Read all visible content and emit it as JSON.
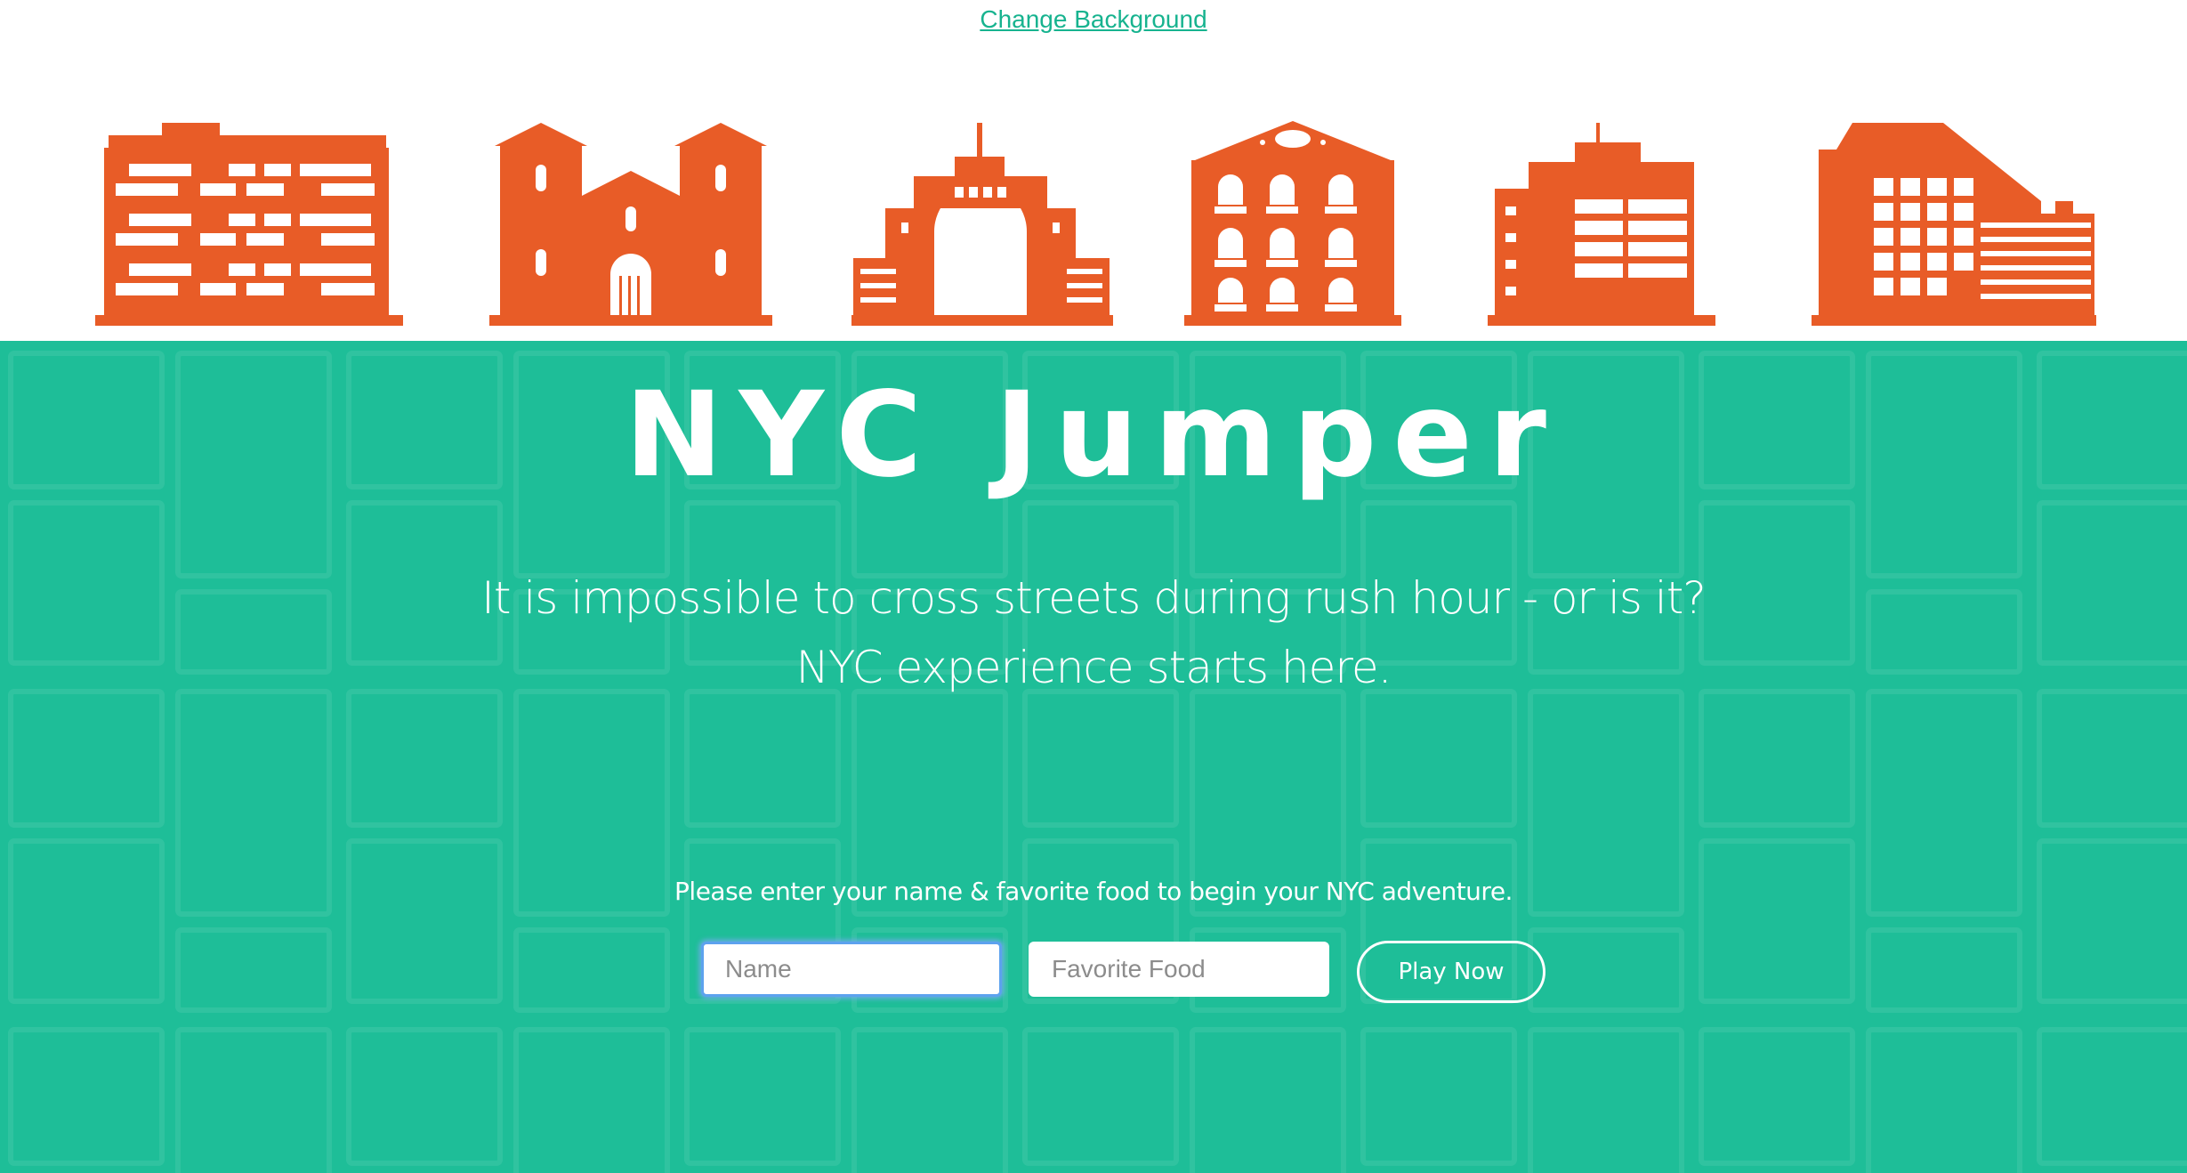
{
  "header": {
    "change_background_label": "Change Background"
  },
  "skyline": {
    "color": "#e85c27",
    "buildings": [
      "apartment-building-icon",
      "church-icon",
      "arch-building-icon",
      "ornate-building-icon",
      "office-building-icon",
      "tower-building-icon"
    ]
  },
  "hero": {
    "background_color": "#1ebe98",
    "title": "NYC Jumper",
    "tagline_line1": "It is impossible to cross streets during rush hour - or is it?",
    "tagline_line2": "NYC experience starts here."
  },
  "form": {
    "instructions": "Please enter your name & favorite food to begin your NYC adventure.",
    "name_placeholder": "Name",
    "name_value": "",
    "food_placeholder": "Favorite Food",
    "food_value": "",
    "play_label": "Play Now"
  }
}
